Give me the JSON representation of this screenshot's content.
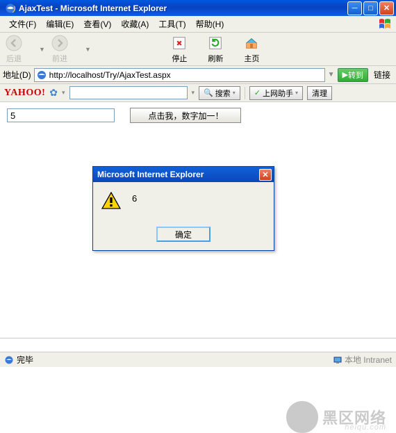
{
  "window": {
    "title": "AjaxTest - Microsoft Internet Explorer"
  },
  "menu": {
    "file": "文件(F)",
    "edit": "编辑(E)",
    "view": "查看(V)",
    "fav": "收藏(A)",
    "tools": "工具(T)",
    "help": "帮助(H)"
  },
  "toolbar": {
    "back": "后退",
    "forward": "前进",
    "stop": "停止",
    "refresh": "刷新",
    "home": "主页"
  },
  "address": {
    "label": "地址(D)",
    "url": "http://localhost/Try/AjaxTest.aspx",
    "go": "转到",
    "links": "链接"
  },
  "yahoo": {
    "logo": "YAHOO!",
    "search_placeholder": "",
    "search_btn": "搜索",
    "helper": "上网助手",
    "clean": "清理"
  },
  "page": {
    "number_value": "5",
    "button_label": "点击我，数字加一！"
  },
  "dialog": {
    "title": "Microsoft Internet Explorer",
    "message": "6",
    "ok": "确定"
  },
  "watermark": {
    "brand": "黑区网络",
    "domain": "heiqu.com"
  },
  "status": {
    "text": "完毕",
    "zone": "本地 Intranet"
  }
}
